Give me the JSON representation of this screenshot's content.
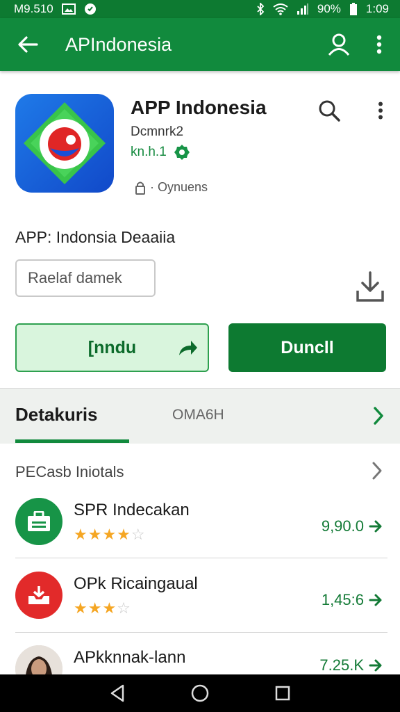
{
  "status_bar": {
    "time": "M9.510",
    "battery": "90%",
    "clock": "1:09"
  },
  "app_bar": {
    "title": "APIndonesia"
  },
  "app": {
    "name": "APP Indonesia",
    "developer": "Dcmnrk2",
    "rating": "kn.h.1",
    "permissions": "· Oynuens"
  },
  "subtitle": "APP: Indonsia Deaaiia",
  "field": {
    "value": "Raelaf damek"
  },
  "buttons": {
    "outline_label": "[nndu",
    "fill_label": "Duncll"
  },
  "tabs": {
    "active": "Detakuris",
    "inactive": "OMA6H"
  },
  "section": {
    "title": "PECasb Iniotals"
  },
  "list": [
    {
      "name": "SPR Indecakan",
      "rating": 4,
      "value": "9,90.0",
      "icon": "briefcase-icon",
      "color": "#179447"
    },
    {
      "name": "OPk Ricaingaual",
      "rating": 3,
      "value": "1,45:6",
      "icon": "inbox-icon",
      "color": "#e22a2a"
    },
    {
      "name": "APkknnak-lann",
      "rating": 0,
      "value": "7.25.K",
      "icon": "avatar",
      "color": "#666666"
    }
  ],
  "colors": {
    "primary": "#118a3d",
    "dark": "#0d7a31",
    "accent": "#d9f5dd"
  }
}
